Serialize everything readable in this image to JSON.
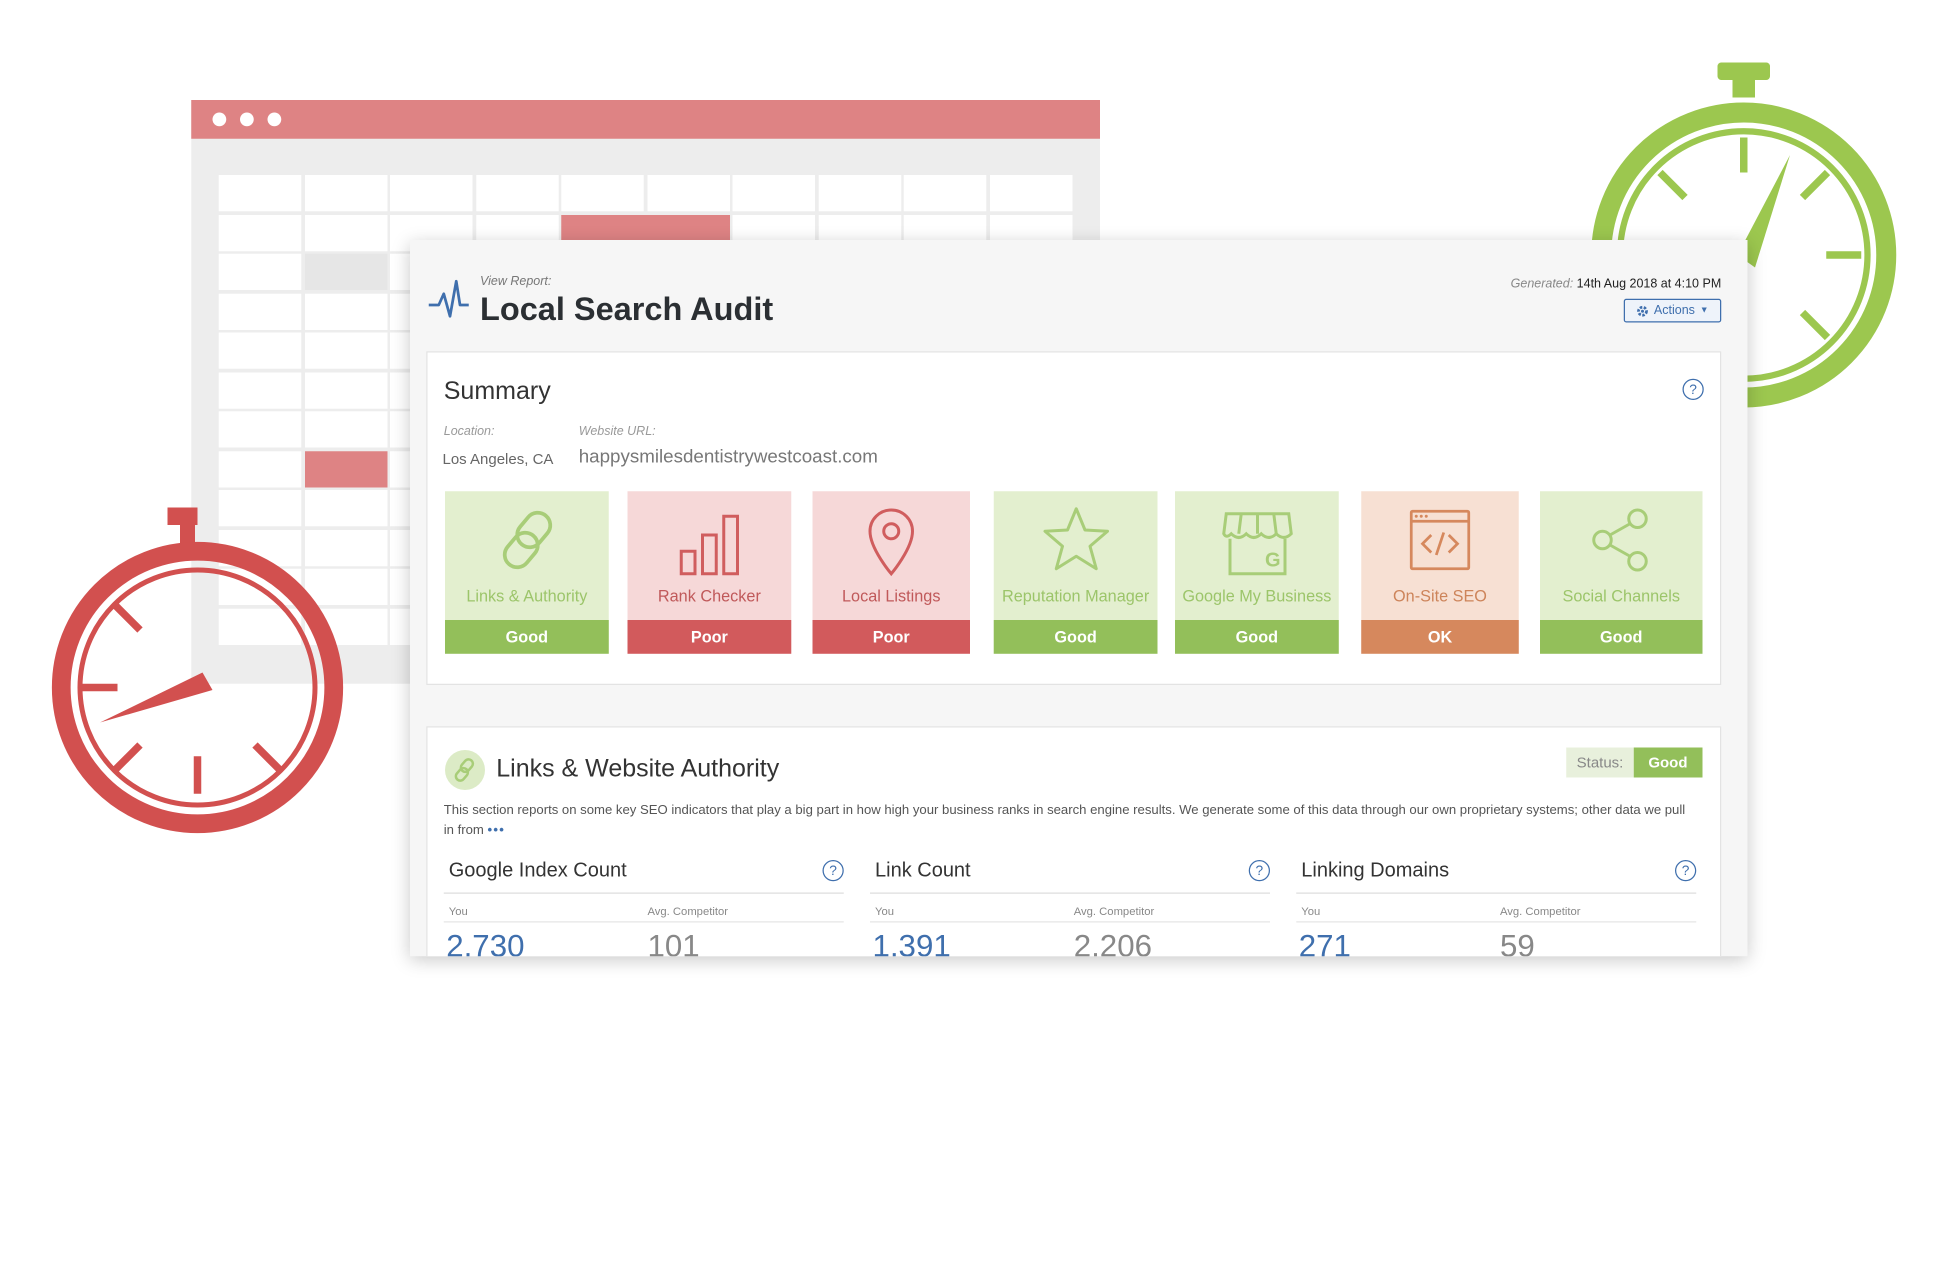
{
  "colors": {
    "brand_blue": "#3f6fad",
    "good": "#93bf5a",
    "poor": "#d25a5c",
    "ok": "#d6885d",
    "timer_green": "#9cc74f",
    "timer_red": "#d2504f",
    "calendar_accent": "#de8384"
  },
  "header": {
    "view_report_label": "View Report:",
    "title": "Local Search Audit",
    "generated_label": "Generated:",
    "generated_value": "14th Aug 2018 at 4:10 PM",
    "actions_label": "Actions",
    "pulse_icon": "pulse-icon",
    "gear_icon": "gear-icon"
  },
  "summary": {
    "title": "Summary",
    "location_label": "Location:",
    "location_value": "Los Angeles, CA",
    "url_label": "Website URL:",
    "url_value": "happysmilesdentistrywestcoast.com",
    "help_symbol": "?",
    "tiles": [
      {
        "name": "Links & Authority",
        "status": "Good",
        "icon": "link-icon"
      },
      {
        "name": "Rank Checker",
        "status": "Poor",
        "icon": "bar-chart-icon"
      },
      {
        "name": "Local Listings",
        "status": "Poor",
        "icon": "map-pin-icon"
      },
      {
        "name": "Reputation Manager",
        "status": "Good",
        "icon": "star-icon"
      },
      {
        "name": "Google My Business",
        "status": "Good",
        "icon": "storefront-icon"
      },
      {
        "name": "On-Site SEO",
        "status": "OK",
        "icon": "code-window-icon"
      },
      {
        "name": "Social Channels",
        "status": "Good",
        "icon": "share-icon"
      }
    ]
  },
  "links_section": {
    "title": "Links & Website Authority",
    "status_label": "Status:",
    "status_value": "Good",
    "description": "This section reports on some key SEO indicators that play a big part in how high your business ranks in search engine results. We generate some of this data through our own proprietary systems; other data we pull in from",
    "more_label": "•••",
    "you_label": "You",
    "competitor_label": "Avg. Competitor",
    "metrics": [
      {
        "title": "Google Index Count",
        "you": "2,730",
        "competitor": "101"
      },
      {
        "title": "Link Count",
        "you": "1,391",
        "competitor": "2,206"
      },
      {
        "title": "Linking Domains",
        "you": "271",
        "competitor": "59"
      }
    ]
  }
}
